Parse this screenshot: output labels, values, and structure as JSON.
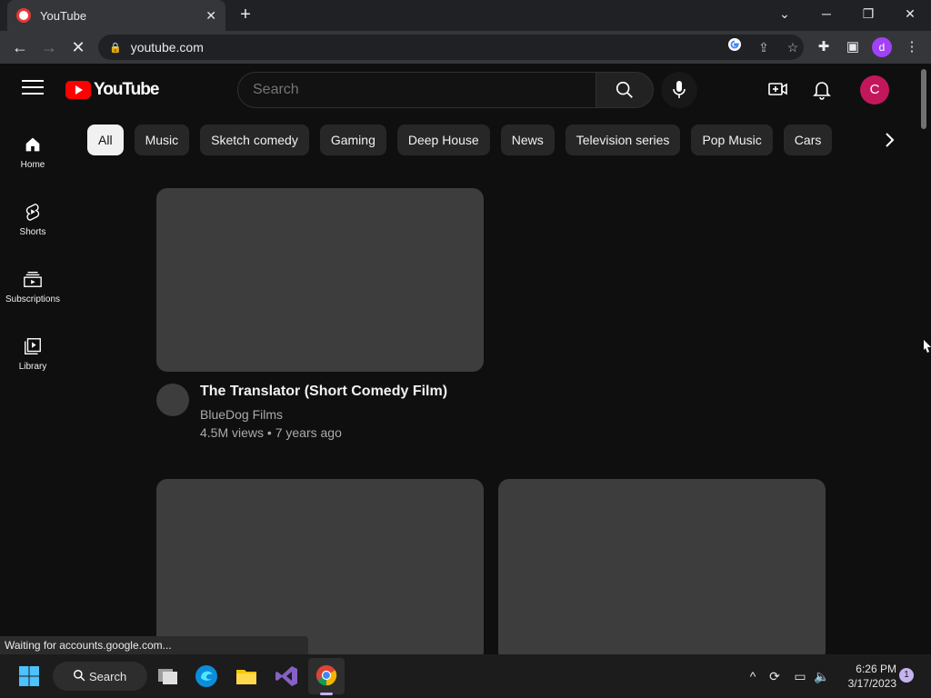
{
  "browser": {
    "tab_title": "YouTube",
    "tab_close": "✕",
    "new_tab": "+",
    "url": "youtube.com",
    "status": "Waiting for accounts.google.com...",
    "profile_initial": "d"
  },
  "youtube": {
    "logo_text": "YouTube",
    "search_placeholder": "Search",
    "avatar_initial": "C",
    "chips": [
      "All",
      "Music",
      "Sketch comedy",
      "Gaming",
      "Deep House",
      "News",
      "Television series",
      "Pop Music",
      "Cars"
    ],
    "guide": [
      {
        "label": "Home"
      },
      {
        "label": "Shorts"
      },
      {
        "label": "Subscriptions"
      },
      {
        "label": "Library"
      }
    ],
    "videos": [
      {
        "title": "The Translator (Short Comedy Film)",
        "channel": "BlueDog Films",
        "meta": "4.5M views • 7 years ago"
      }
    ]
  },
  "taskbar": {
    "search_label": "Search",
    "time": "6:26 PM",
    "date": "3/17/2023",
    "notifications": "1"
  },
  "colors": {
    "youtube_red": "#ff0000",
    "avatar": "#c2185b",
    "profile": "#a142f4"
  }
}
